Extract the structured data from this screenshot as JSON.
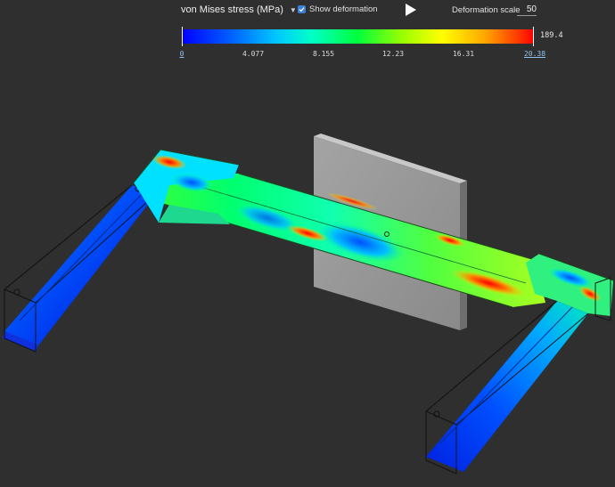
{
  "toolbar": {
    "result_type": "von Mises stress (MPa)",
    "show_deformation_label": "Show deformation",
    "show_deformation_checked": true,
    "deformation_scale_label": "Deformation scale",
    "deformation_scale_value": "50"
  },
  "legend": {
    "min": "0",
    "ticks": [
      "4.077",
      "8.155",
      "12.23",
      "16.31"
    ],
    "upper": "20.38",
    "max": "189.4",
    "colors": [
      "#0000ff",
      "#00c8ff",
      "#00ff3c",
      "#ffff00",
      "#ff0000"
    ]
  },
  "icons": {
    "dropdown": "chevron-down-icon",
    "play": "play-icon",
    "checkbox": "checkbox-checked-icon"
  }
}
